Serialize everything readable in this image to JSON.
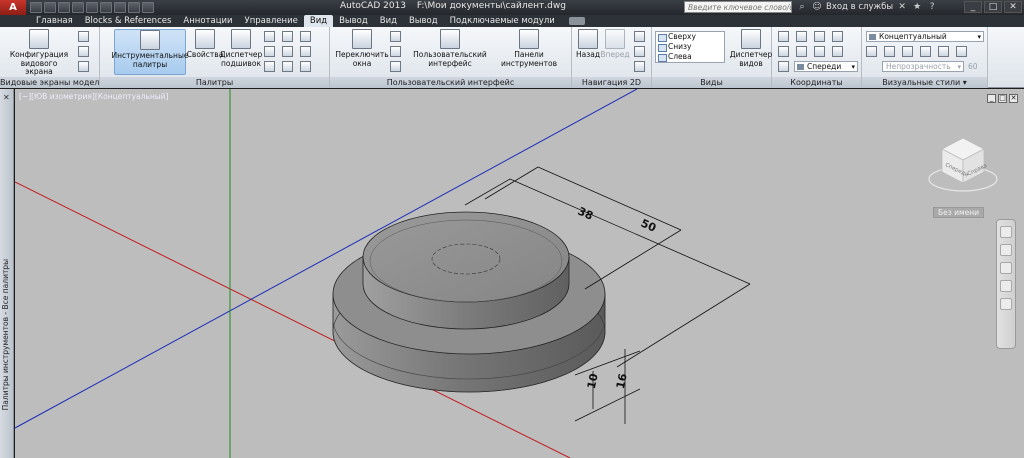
{
  "titlebar": {
    "app_name": "AutoCAD 2013",
    "file_path": "F:\\Мои документы\\сайлент.dwg",
    "search_placeholder": "Введите ключевое слово/фразу",
    "signin_label": "Вход в службы"
  },
  "tabs": [
    {
      "label": "Главная"
    },
    {
      "label": "Blocks & References"
    },
    {
      "label": "Аннотации"
    },
    {
      "label": "Управление"
    },
    {
      "label": "Вид",
      "active": true
    },
    {
      "label": "Вывод"
    },
    {
      "label": "Вид"
    },
    {
      "label": "Вывод"
    },
    {
      "label": "Подключаемые модули"
    }
  ],
  "ribbon": {
    "panels": {
      "viewports": {
        "title": "Видовые экраны модели",
        "config_label": "Конфигурация\nвидового экрана"
      },
      "palettes": {
        "title": "Палитры",
        "tool_palettes": "Инструментальные\nпалитры",
        "properties": "Свойства",
        "sheet_set": "Диспетчер\nподшивок"
      },
      "ui": {
        "title": "Пользовательский интерфейс",
        "switch_windows": "Переключить\nокна",
        "user_interface": "Пользовательский\nинтерфейс",
        "toolbars": "Панели инструментов"
      },
      "nav2d": {
        "title": "Навигация 2D",
        "back": "Назад",
        "forward": "Вперед"
      },
      "views": {
        "title": "Виды",
        "list": [
          "Сверху",
          "Снизу",
          "Слева"
        ],
        "manager": "Диспетчер\nвидов"
      },
      "coords": {
        "title": "Координаты",
        "ucs_combo": "Спереди"
      },
      "visual": {
        "title": "Визуальные стили",
        "style_combo": "Концептуальный",
        "opacity_label": "Непрозрачность",
        "opacity_value": "60"
      }
    }
  },
  "sidebar": {
    "label": "Палитры инструментов - Все палитры"
  },
  "viewport": {
    "label": "[−][ЮВ изометрия][Концептуальный]",
    "viewcube_name": "Без имени",
    "viewcube_faces": {
      "front": "Спереди",
      "right": "Справа"
    }
  },
  "dimensions": {
    "d1": "38",
    "d2": "50",
    "h1": "10",
    "h2": "16"
  },
  "colors": {
    "x_axis": "#c21d1d",
    "y_axis": "#1a2db8",
    "z_axis": "#1f8a1f",
    "model": "#8d8d8d",
    "background": "#bdbdbd"
  }
}
